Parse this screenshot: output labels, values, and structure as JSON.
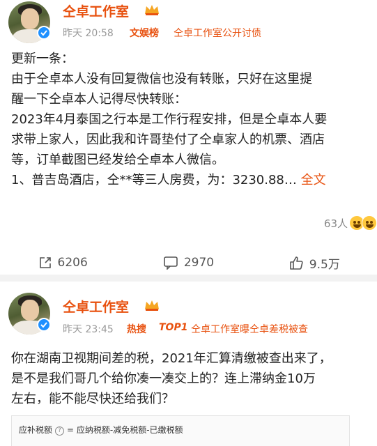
{
  "post1": {
    "author": "仝卓工作室",
    "time": "昨天 20:58",
    "source_tag": "文娱榜",
    "source_info": "仝卓工作室公开讨债",
    "content_lines": [
      "更新一条：",
      "由于仝卓本人没有回复微信也没有转账，只好在这里提",
      "醒一下仝卓本人记得尽快转账：",
      "2023年4月泰国之行本是工作行程安排，但是仝卓本人要",
      "求带上家人，因此我和许哥垫付了仝卓家人的机票、酒店",
      "等，订单截图已经发给仝卓本人微信。",
      "1、普吉岛酒店，仝**等三人房费，为：3230.88…"
    ],
    "full_text_label": "全文",
    "reaction_count": "63人",
    "share_count": "6206",
    "comment_count": "2970",
    "like_count": "9.5万"
  },
  "post2": {
    "author": "仝卓工作室",
    "time": "昨天 23:45",
    "hot_tag": "热搜",
    "rank_tag": "TOP1",
    "hot_topic": "仝卓工作室曝仝卓差税被查",
    "content_lines": [
      "你在湖南卫视期间差的税，2021年汇算清缴被查出来了，",
      "是不是我们哥几个给你凑一凑交上的？连上滞纳金10万",
      "左右，能不能尽快还给我们？"
    ]
  },
  "tax_image": {
    "label": "应补税额",
    "formula": "= 应纳税额-减免税额-已缴税额"
  },
  "colors": {
    "accent": "#e8510f",
    "verified": "#1e90ff",
    "muted": "#999999"
  },
  "icons": [
    "verified-icon",
    "vip-crown-icon",
    "share-icon",
    "comment-icon",
    "like-icon",
    "help-icon",
    "emoji-reaction-icon"
  ]
}
